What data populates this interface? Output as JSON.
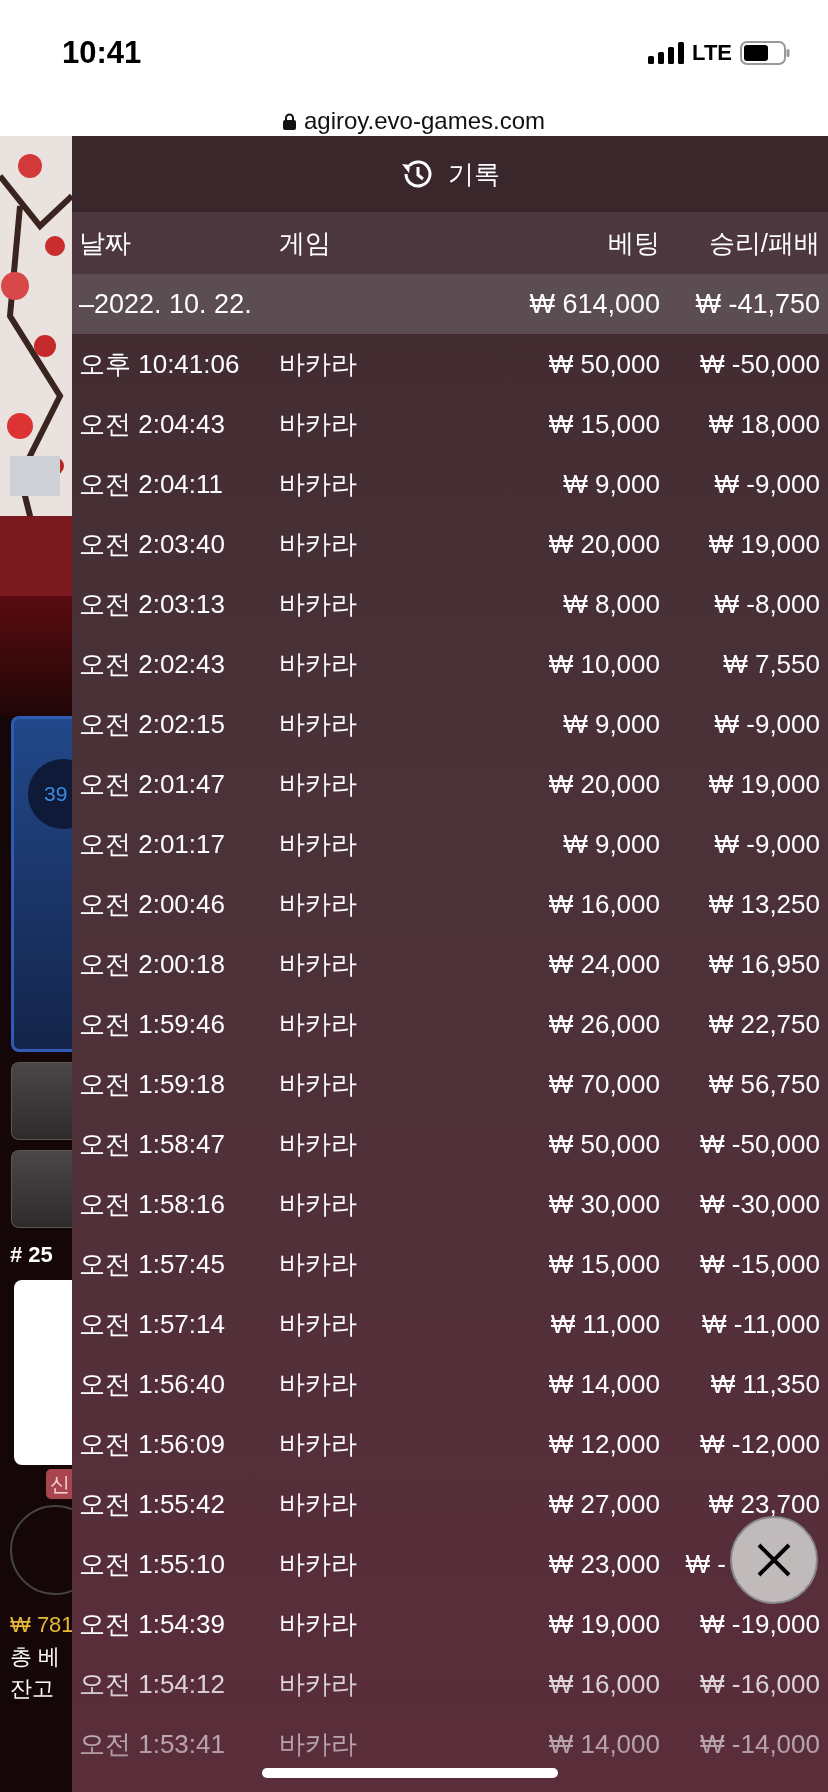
{
  "status_bar": {
    "time": "10:41",
    "network": "LTE"
  },
  "address_bar": {
    "url": "agiroy.evo-games.com"
  },
  "background_app": {
    "progress_label": "39",
    "round_label": "# 25",
    "badge": "신",
    "balance_amount": "₩ 781",
    "total_bet_label": "총 베",
    "balance_label": "잔고"
  },
  "history_panel": {
    "title": "기록",
    "columns": [
      "날짜",
      "게임",
      "베팅",
      "승리/패배"
    ],
    "summary": {
      "date": "–2022. 10. 22.",
      "bet": "₩ 614,000",
      "result": "₩ -41,750"
    },
    "rows": [
      {
        "time": "오후 10:41:06",
        "game": "바카라",
        "bet": "₩ 50,000",
        "result": "₩ -50,000"
      },
      {
        "time": "오전 2:04:43",
        "game": "바카라",
        "bet": "₩ 15,000",
        "result": "₩ 18,000"
      },
      {
        "time": "오전 2:04:11",
        "game": "바카라",
        "bet": "₩ 9,000",
        "result": "₩ -9,000"
      },
      {
        "time": "오전 2:03:40",
        "game": "바카라",
        "bet": "₩ 20,000",
        "result": "₩ 19,000"
      },
      {
        "time": "오전 2:03:13",
        "game": "바카라",
        "bet": "₩ 8,000",
        "result": "₩ -8,000"
      },
      {
        "time": "오전 2:02:43",
        "game": "바카라",
        "bet": "₩ 10,000",
        "result": "₩ 7,550"
      },
      {
        "time": "오전 2:02:15",
        "game": "바카라",
        "bet": "₩ 9,000",
        "result": "₩ -9,000"
      },
      {
        "time": "오전 2:01:47",
        "game": "바카라",
        "bet": "₩ 20,000",
        "result": "₩ 19,000"
      },
      {
        "time": "오전 2:01:17",
        "game": "바카라",
        "bet": "₩ 9,000",
        "result": "₩ -9,000"
      },
      {
        "time": "오전 2:00:46",
        "game": "바카라",
        "bet": "₩ 16,000",
        "result": "₩ 13,250"
      },
      {
        "time": "오전 2:00:18",
        "game": "바카라",
        "bet": "₩ 24,000",
        "result": "₩ 16,950"
      },
      {
        "time": "오전 1:59:46",
        "game": "바카라",
        "bet": "₩ 26,000",
        "result": "₩ 22,750"
      },
      {
        "time": "오전 1:59:18",
        "game": "바카라",
        "bet": "₩ 70,000",
        "result": "₩ 56,750"
      },
      {
        "time": "오전 1:58:47",
        "game": "바카라",
        "bet": "₩ 50,000",
        "result": "₩ -50,000"
      },
      {
        "time": "오전 1:58:16",
        "game": "바카라",
        "bet": "₩ 30,000",
        "result": "₩ -30,000"
      },
      {
        "time": "오전 1:57:45",
        "game": "바카라",
        "bet": "₩ 15,000",
        "result": "₩ -15,000"
      },
      {
        "time": "오전 1:57:14",
        "game": "바카라",
        "bet": "₩ 11,000",
        "result": "₩ -11,000"
      },
      {
        "time": "오전 1:56:40",
        "game": "바카라",
        "bet": "₩ 14,000",
        "result": "₩ 11,350"
      },
      {
        "time": "오전 1:56:09",
        "game": "바카라",
        "bet": "₩ 12,000",
        "result": "₩ -12,000"
      },
      {
        "time": "오전 1:55:42",
        "game": "바카라",
        "bet": "₩ 27,000",
        "result": "₩ 23,700"
      },
      {
        "time": "오전 1:55:10",
        "game": "바카라",
        "bet": "₩ 23,000",
        "result": "₩ -",
        "under_close_button": true
      },
      {
        "time": "오전 1:54:39",
        "game": "바카라",
        "bet": "₩ 19,000",
        "result": "₩ -19,000"
      },
      {
        "time": "오전 1:54:12",
        "game": "바카라",
        "bet": "₩ 16,000",
        "result": "₩ -16,000"
      },
      {
        "time": "오전 1:53:41",
        "game": "바카라",
        "bet": "₩ 14,000",
        "result": "₩ -14,000"
      }
    ]
  }
}
